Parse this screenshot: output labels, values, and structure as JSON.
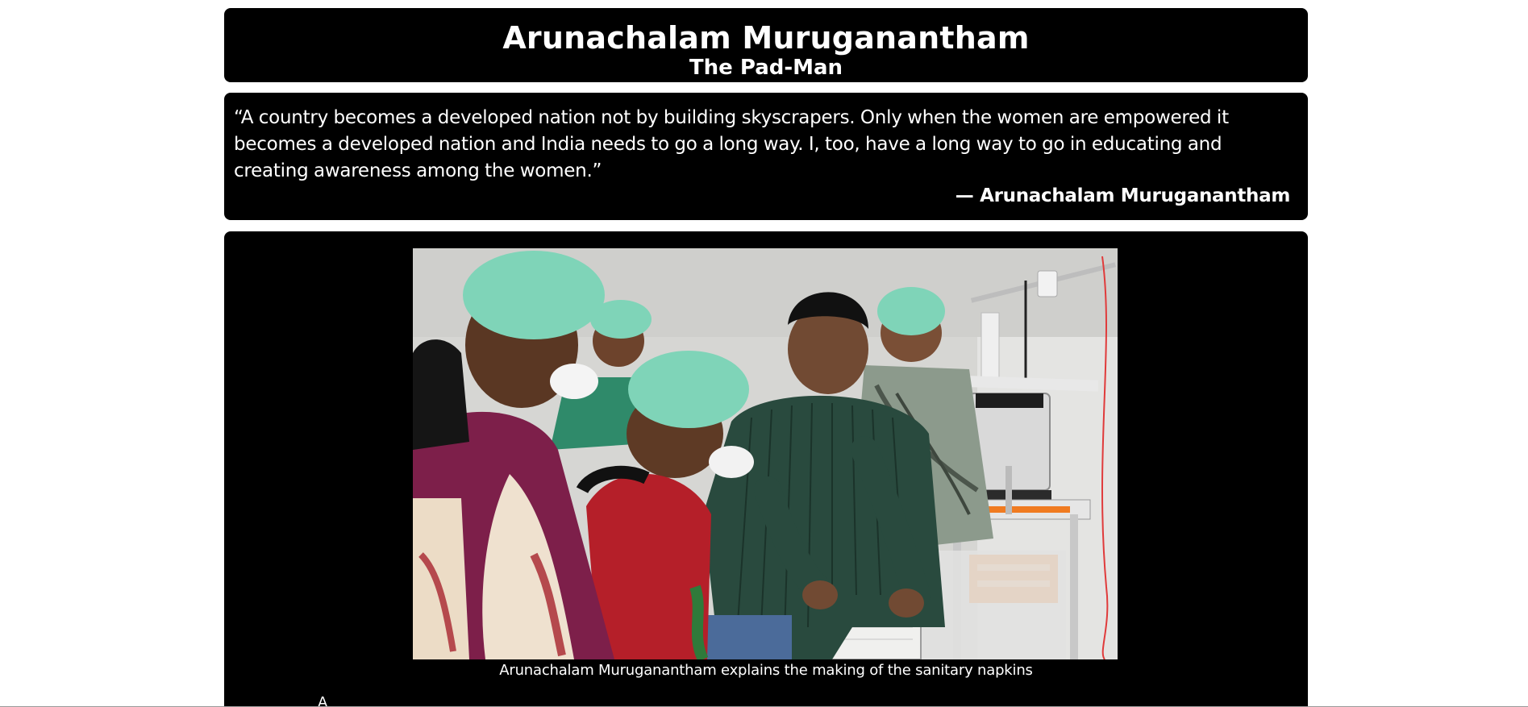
{
  "header": {
    "title": "Arunachalam Muruganantham",
    "subtitle": "The Pad-Man"
  },
  "quote": {
    "text": "“A country becomes a developed nation not by building skyscrapers. Only when the women are empowered it becomes a developed nation and India needs to go a long way. I, too, have a long way to go in educating and creating awareness among the women.”",
    "attribution": "— Arunachalam Muruganantham"
  },
  "figure": {
    "image_subject": "Arunachalam Muruganantham with women workers in hairnets and masks at a sanitary napkin making machine",
    "caption": "Arunachalam Muruganantham explains the making of the sanitary napkins",
    "next_section_peek": "A"
  },
  "colors": {
    "card_background": "#000000",
    "page_background": "#ffffff",
    "text": "#ffffff"
  }
}
